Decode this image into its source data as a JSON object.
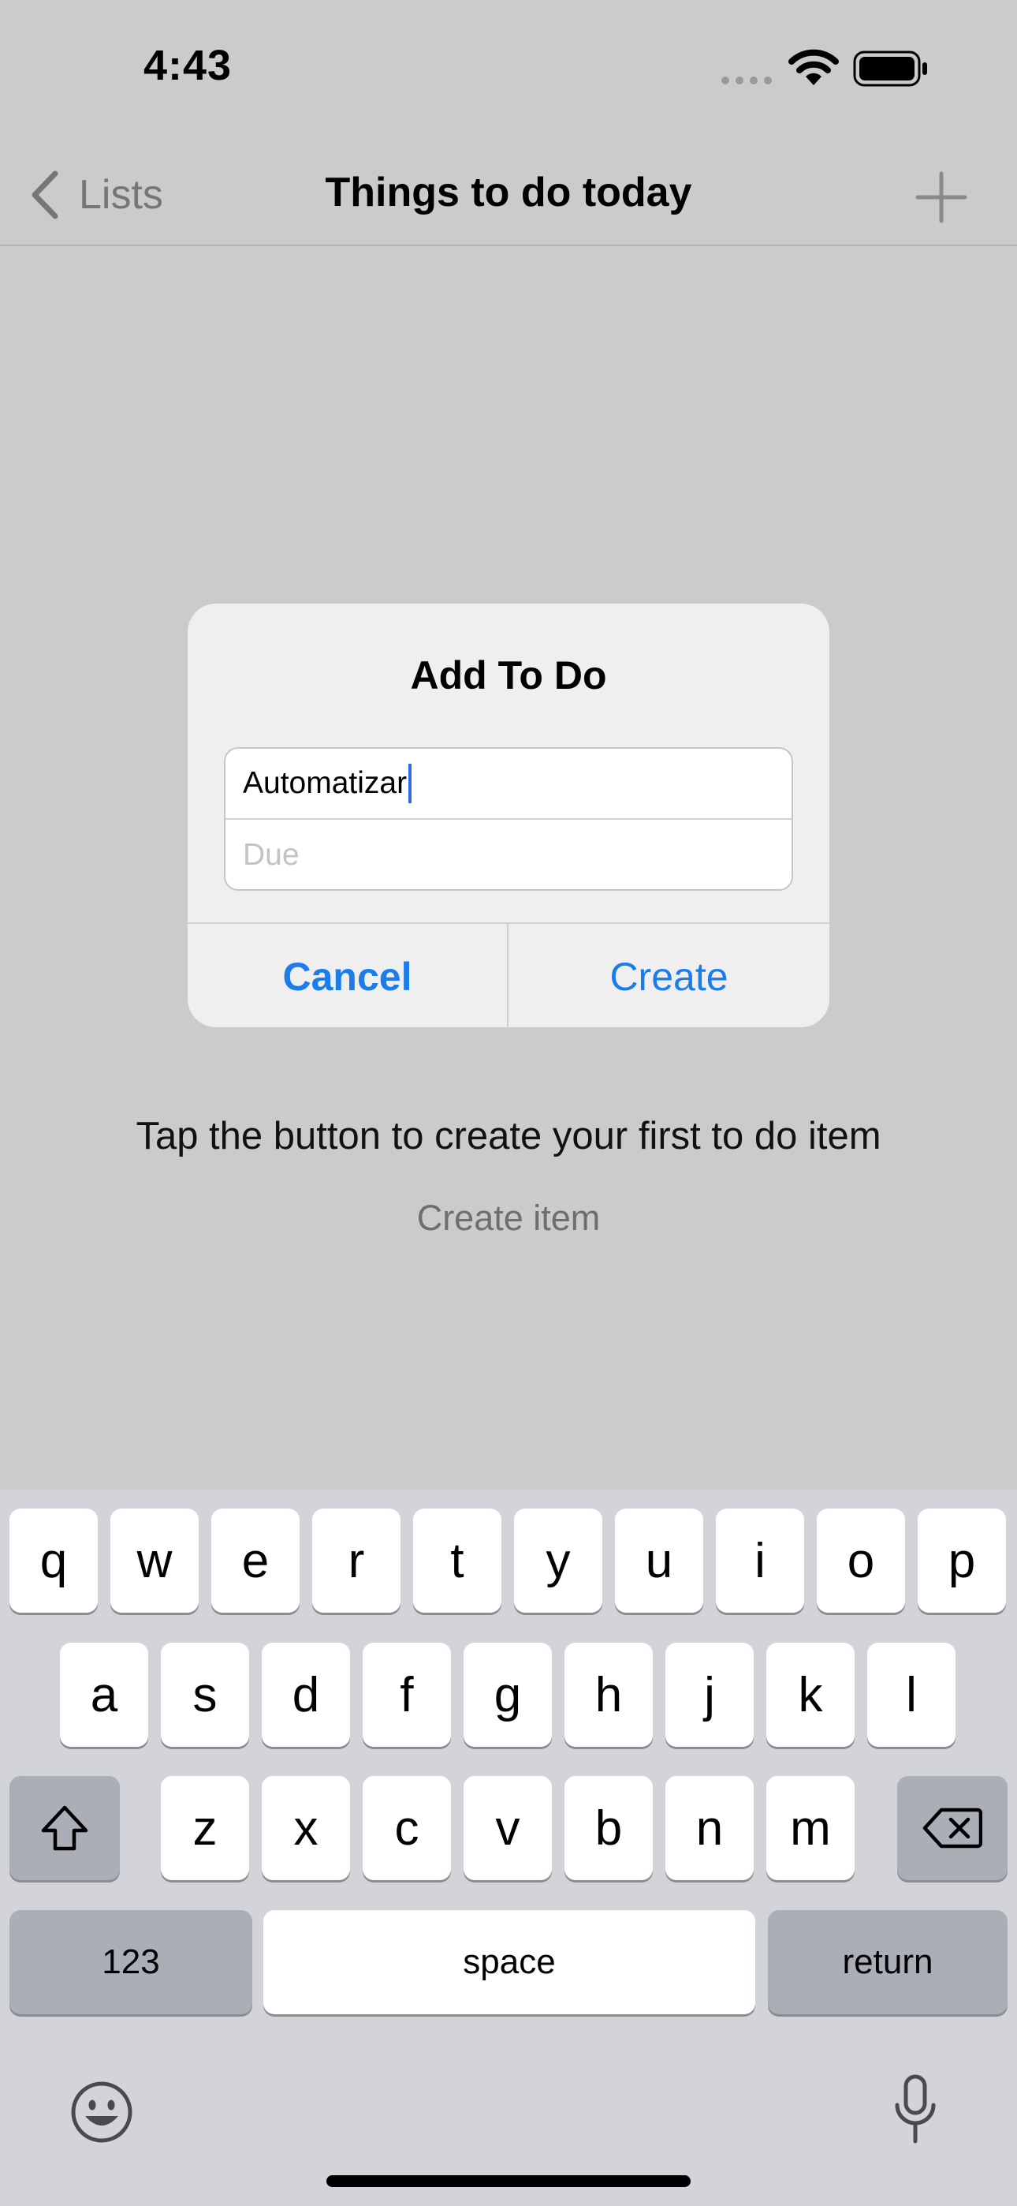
{
  "status_bar": {
    "time": "4:43",
    "icons": [
      "cellular-signal-icon",
      "wifi-icon",
      "battery-icon"
    ]
  },
  "nav": {
    "back_label": "Lists",
    "title": "Things to do today",
    "add_icon": "plus-icon"
  },
  "empty_state": {
    "message": "Tap the button to create your first to do item",
    "create_link": "Create item"
  },
  "alert": {
    "title": "Add To Do",
    "todo_field_value": "Automatizar",
    "due_placeholder": "Due",
    "cancel_label": "Cancel",
    "create_label": "Create",
    "accent_color": "#1b7cea"
  },
  "keyboard": {
    "row1": [
      "q",
      "w",
      "e",
      "r",
      "t",
      "y",
      "u",
      "i",
      "o",
      "p"
    ],
    "row2": [
      "a",
      "s",
      "d",
      "f",
      "g",
      "h",
      "j",
      "k",
      "l"
    ],
    "row3": [
      "z",
      "x",
      "c",
      "v",
      "b",
      "n",
      "m"
    ],
    "numbers_label": "123",
    "space_label": "space",
    "return_label": "return",
    "icons": [
      "shift-icon",
      "delete-icon",
      "emoji-icon",
      "microphone-icon"
    ]
  }
}
